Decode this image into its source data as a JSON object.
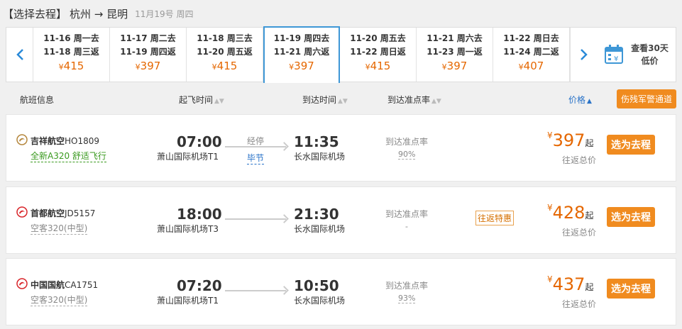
{
  "title": {
    "step": "【选择去程】",
    "route": "杭州 → 昆明",
    "date": "11月19号 周四"
  },
  "date_strip": {
    "prev_icon": "chevron-left-icon",
    "next_icon": "chevron-right-icon",
    "cells": [
      {
        "go": "11-16 周一去",
        "ret": "11-18 周三返",
        "price": "415",
        "active": false
      },
      {
        "go": "11-17 周二去",
        "ret": "11-19 周四返",
        "price": "397",
        "active": false
      },
      {
        "go": "11-18 周三去",
        "ret": "11-20 周五返",
        "price": "415",
        "active": false
      },
      {
        "go": "11-19 周四去",
        "ret": "11-21 周六返",
        "price": "397",
        "active": true
      },
      {
        "go": "11-20 周五去",
        "ret": "11-22 周日返",
        "price": "415",
        "active": false
      },
      {
        "go": "11-21 周六去",
        "ret": "11-23 周一返",
        "price": "397",
        "active": false
      },
      {
        "go": "11-22 周日去",
        "ret": "11-24 周二返",
        "price": "407",
        "active": false
      }
    ],
    "currency": "¥",
    "low_price_line1": "查看30天",
    "low_price_line2": "低价"
  },
  "header": {
    "info": "航班信息",
    "dep": "起飞时间",
    "arr": "到达时间",
    "punct": "到达准点率",
    "price": "价格",
    "police": "伤残军警通道"
  },
  "flights": [
    {
      "airline": "吉祥航空",
      "flight_no": "HO1809",
      "plane": "全新A320 舒适飞行",
      "dep_time": "07:00",
      "dep_airport": "萧山国际机场T1",
      "stop_label": "经停",
      "stop_city": "毕节",
      "arr_time": "11:35",
      "arr_airport": "长水国际机场",
      "punct_label": "到达准点率",
      "punct": "90%",
      "badge": "",
      "currency": "¥",
      "price": "397",
      "qi": "起",
      "total": "往返总价",
      "select": "选为去程",
      "logo_color": "#b5873d"
    },
    {
      "airline": "首都航空",
      "flight_no": "JD5157",
      "plane": "空客320(中型)",
      "dep_time": "18:00",
      "dep_airport": "萧山国际机场T3",
      "stop_label": "",
      "stop_city": "",
      "arr_time": "21:30",
      "arr_airport": "长水国际机场",
      "punct_label": "到达准点率",
      "punct": "-",
      "badge": "往返特惠",
      "currency": "¥",
      "price": "428",
      "qi": "起",
      "total": "往返总价",
      "select": "选为去程",
      "logo_color": "#d9252a"
    },
    {
      "airline": "中国国航",
      "flight_no": "CA1751",
      "plane": "空客320(中型)",
      "dep_time": "07:20",
      "dep_airport": "萧山国际机场T1",
      "stop_label": "",
      "stop_city": "",
      "arr_time": "10:50",
      "arr_airport": "长水国际机场",
      "punct_label": "到达准点率",
      "punct": "93%",
      "badge": "",
      "currency": "¥",
      "price": "437",
      "qi": "起",
      "total": "往返总价",
      "select": "选为去程",
      "logo_color": "#d9252a"
    }
  ]
}
